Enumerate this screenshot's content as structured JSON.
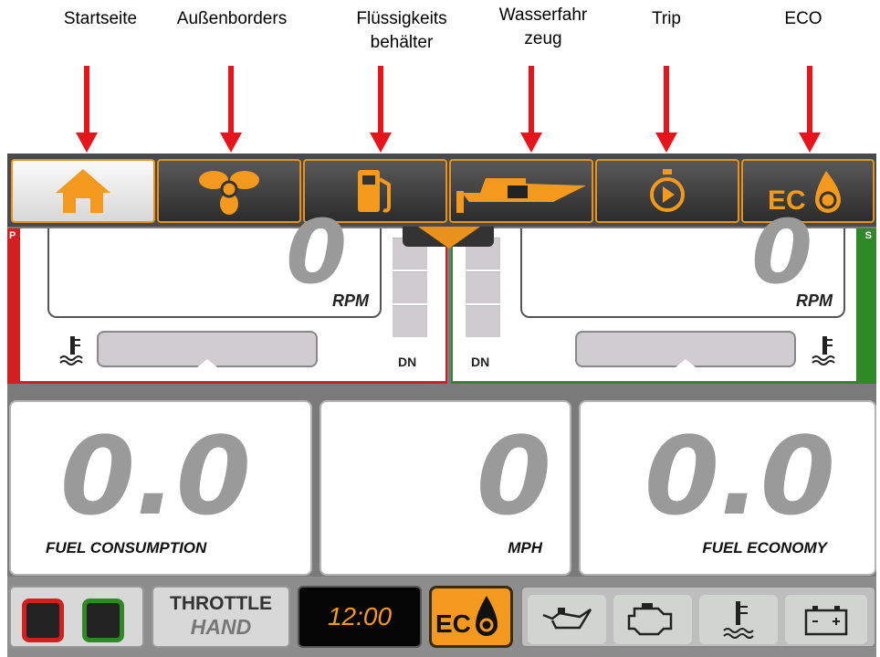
{
  "callouts": [
    {
      "label": "Startseite"
    },
    {
      "label": "Außenborders"
    },
    {
      "label": "Flüssigkeits\nbehälter"
    },
    {
      "label": "Wasserfahr\nzeug"
    },
    {
      "label": "Trip"
    },
    {
      "label": "ECO"
    }
  ],
  "nav": {
    "tabs": [
      {
        "icon": "home-icon",
        "active": true
      },
      {
        "icon": "propeller-icon",
        "active": false
      },
      {
        "icon": "fuel-pump-icon",
        "active": false
      },
      {
        "icon": "boat-icon",
        "active": false
      },
      {
        "icon": "trip-icon",
        "active": false
      },
      {
        "icon": "eco-icon",
        "active": false
      }
    ],
    "eco_tab_text": "EC"
  },
  "engines": {
    "left": {
      "rpm_value": "0",
      "rpm_label": "RPM",
      "gear_label": "DN",
      "side_label": "P",
      "accent": "#d21f1f"
    },
    "right": {
      "rpm_value": "0",
      "rpm_label": "RPM",
      "gear_label": "DN",
      "side_label": "S",
      "accent": "#2f8a26"
    }
  },
  "readouts": {
    "fuel_consumption": {
      "value": "0.0",
      "label": "FUEL CONSUMPTION"
    },
    "speed": {
      "value": "0",
      "label": "MPH"
    },
    "fuel_economy": {
      "value": "0.0",
      "label": "FUEL ECONOMY"
    }
  },
  "status": {
    "throttle_line1": "THROTTLE",
    "throttle_line2": "HAND",
    "clock": "12:00",
    "eco_button_text": "EC",
    "warnings": [
      "oil-icon",
      "engine-check-icon",
      "water-temp-icon",
      "battery-icon"
    ]
  },
  "colors": {
    "accent_orange": "#f39a1e",
    "port_red": "#d21f1f",
    "starboard_green": "#2f8a26",
    "arrow_red": "#e8141b"
  }
}
